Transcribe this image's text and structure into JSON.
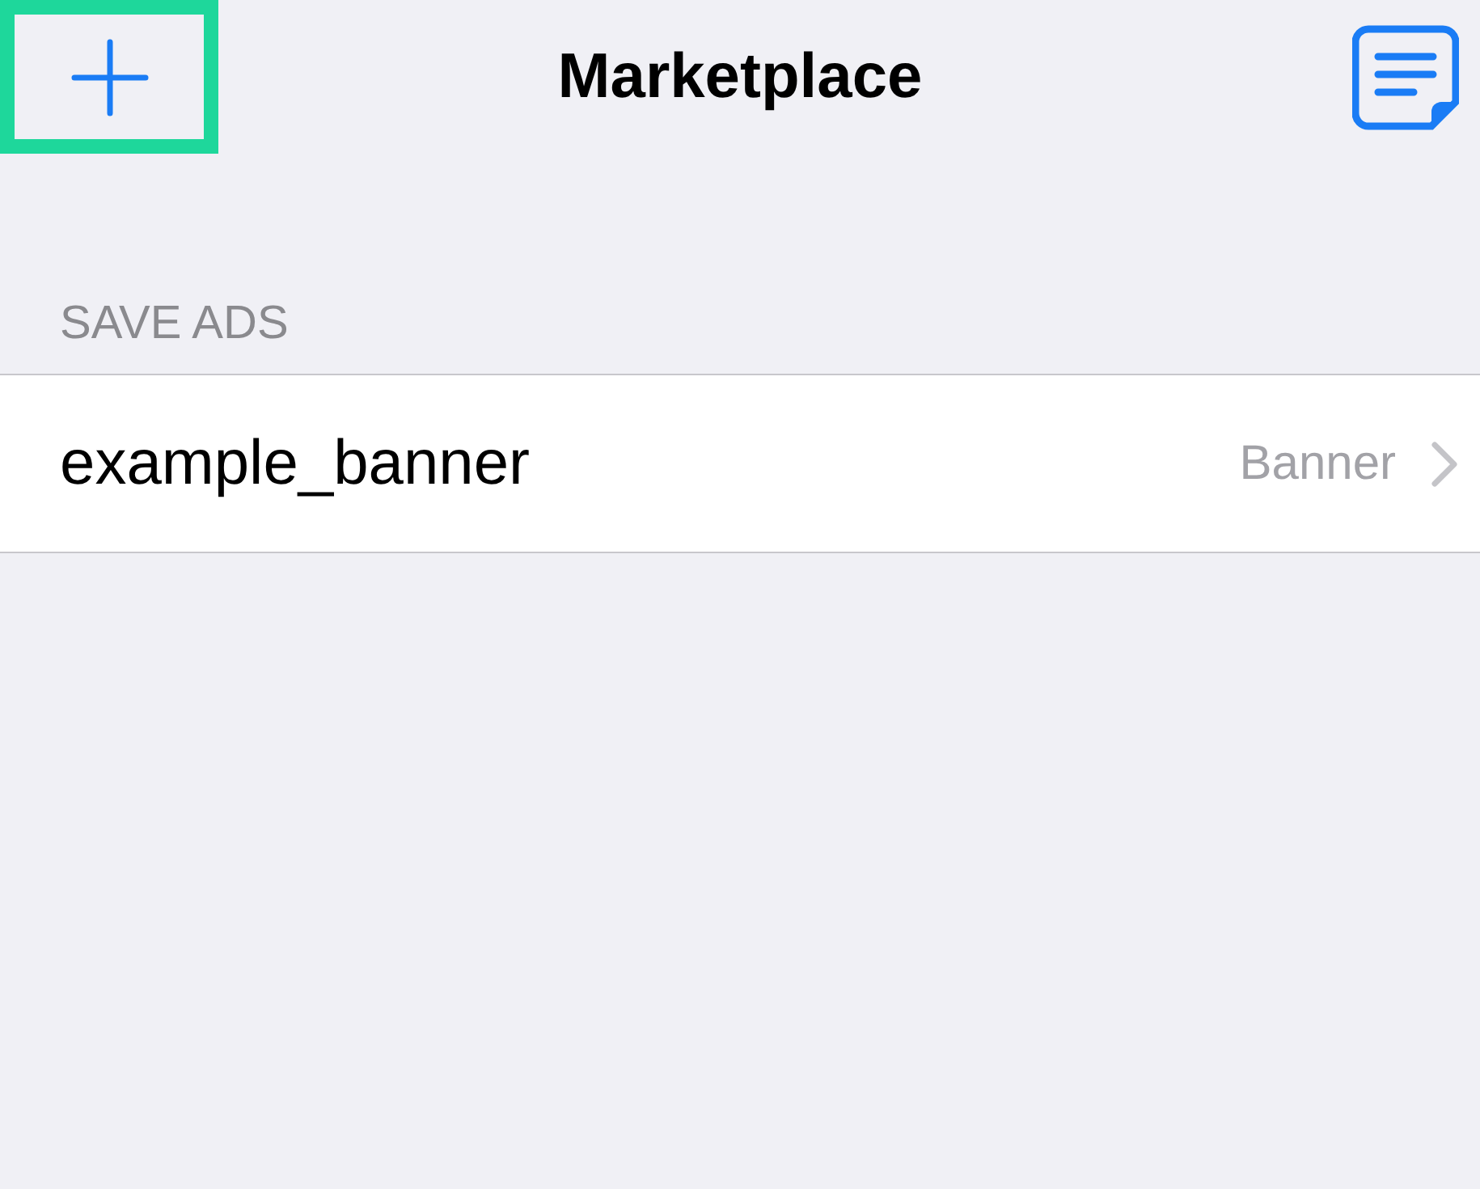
{
  "nav_bar": {
    "title": "Marketplace",
    "add_button": {
      "highlighted": true
    }
  },
  "sections": [
    {
      "header": "SAVE ADS",
      "rows": [
        {
          "name": "example_banner",
          "detail": "Banner"
        }
      ]
    }
  ]
}
